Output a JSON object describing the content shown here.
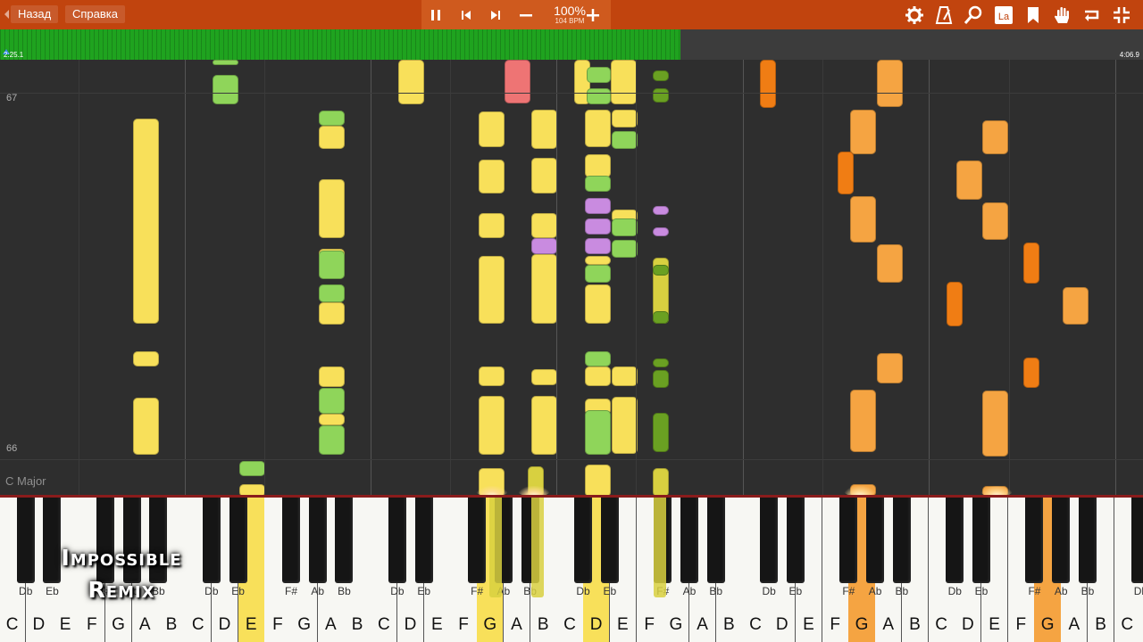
{
  "toolbar": {
    "back_label": "Назад",
    "help_label": "Справка",
    "tempo_percent": "100%",
    "tempo_bpm": "104 BPM",
    "icons": [
      "gear-icon",
      "metronome-icon",
      "zoom-icon",
      "note-labels-icon",
      "bookmark-icon",
      "hand-icon",
      "loop-icon",
      "exit-fullscreen-icon"
    ]
  },
  "progress": {
    "elapsed": "2:25.1",
    "total": "4:06.9",
    "fraction": 0.595
  },
  "roll": {
    "measure_top": "67",
    "measure_bottom": "66",
    "key_signature": "C Major"
  },
  "overlay": {
    "line1": "Impossible",
    "line2": "Remix"
  },
  "colors": {
    "toolbar": "#c1440e",
    "progress": "#1fa31f",
    "yellow_notes": "#f8e05a",
    "green_notes": "#8fd55a",
    "orange_notes": "#f5a442"
  },
  "keyboard": {
    "white_labels": [
      "C",
      "D",
      "E",
      "F",
      "G",
      "A",
      "B",
      "C",
      "D",
      "E",
      "F",
      "G",
      "A",
      "B",
      "C",
      "D",
      "E",
      "F",
      "G",
      "A",
      "B",
      "C",
      "D",
      "E",
      "F",
      "G",
      "A",
      "B",
      "C",
      "D",
      "E",
      "F",
      "G",
      "A",
      "B",
      "C",
      "D",
      "E",
      "F",
      "G",
      "A",
      "B",
      "C",
      "D",
      "E",
      "F",
      "G",
      "A",
      "B"
    ],
    "black_labels": [
      "Db",
      "Eb",
      "F#",
      "Ab",
      "Bb",
      "Db",
      "Eb",
      "F#",
      "Ab",
      "Bb",
      "Db",
      "Eb",
      "F#",
      "Ab",
      "Bb",
      "Db",
      "Eb",
      "F#",
      "Ab",
      "Bb",
      "Db",
      "Eb",
      "F#",
      "Ab",
      "Bb",
      "Db",
      "Eb",
      "F#",
      "Ab",
      "Bb",
      "Db",
      "Eb",
      "F#",
      "Ab",
      "Bb"
    ]
  }
}
